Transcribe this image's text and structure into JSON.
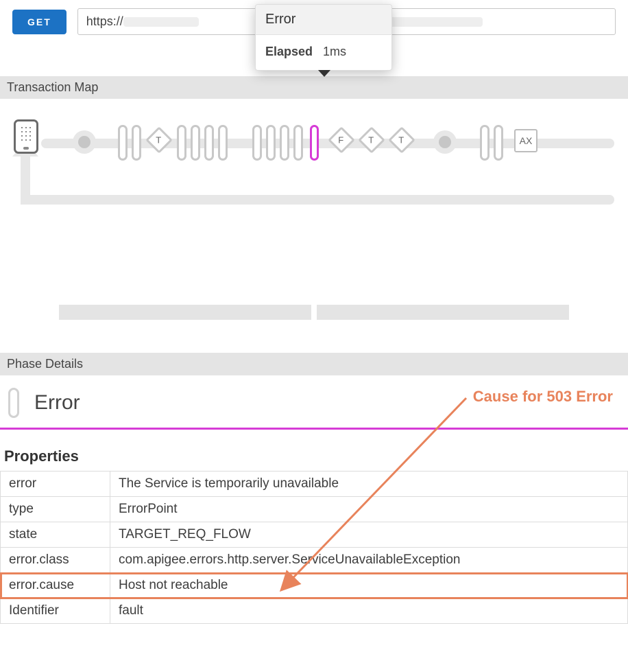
{
  "toprow": {
    "method_label": "GET",
    "url_prefix": "https://"
  },
  "tooltip": {
    "title": "Error",
    "elapsed_label": "Elapsed",
    "elapsed_value": "1ms"
  },
  "sections": {
    "tmap_title": "Transaction Map",
    "phase_title": "Phase Details"
  },
  "tmap": {
    "diamond_t": "T",
    "diamond_f": "F",
    "ax_label": "AX"
  },
  "phase": {
    "heading": "Error",
    "callout": "Cause for 503 Error"
  },
  "properties": {
    "title": "Properties",
    "rows": [
      {
        "k": "error",
        "v": "The Service is temporarily unavailable"
      },
      {
        "k": "type",
        "v": "ErrorPoint"
      },
      {
        "k": "state",
        "v": "TARGET_REQ_FLOW"
      },
      {
        "k": "error.class",
        "v": "com.apigee.errors.http.server.ServiceUnavailableException"
      },
      {
        "k": "error.cause",
        "v": "Host not reachable"
      },
      {
        "k": "Identifier",
        "v": "fault"
      }
    ],
    "highlight_index": 4
  }
}
